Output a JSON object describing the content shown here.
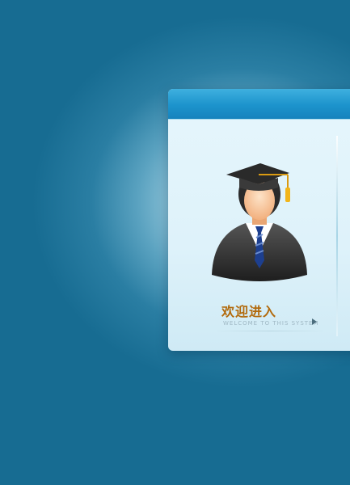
{
  "panel": {
    "title": "",
    "welcome_text": "欢迎进入",
    "welcome_subtitle": "WELCOME TO THIS SYSTEM",
    "avatar_icon": "graduate-avatar-icon",
    "arrow_icon": "arrow-right-icon"
  },
  "colors": {
    "background": "#176c92",
    "header": "#1c93cc",
    "panel": "#e6f6fc",
    "welcome_text": "#b26a0d"
  }
}
